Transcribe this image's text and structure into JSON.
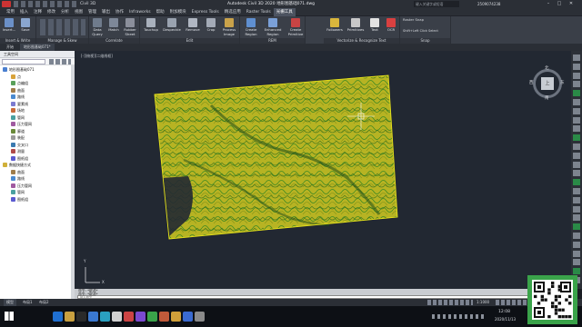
{
  "titlebar": {
    "app_label": "Civil 3D",
    "title": "Autodesk Civil 3D 2020  地形图基础071.dwg",
    "search_placeholder": "键入关键字或短语",
    "user": "2509074238"
  },
  "tabs": [
    "常用",
    "插入",
    "注释",
    "修改",
    "分析",
    "视图",
    "管理",
    "输出",
    "协作",
    "Infraworks",
    "帮助",
    "附加模块",
    "Express Tools",
    "精选应用",
    "Raster Tools",
    "光栅工具"
  ],
  "tabs_active_index": 15,
  "ribbon": {
    "panels": [
      {
        "title": "Insert & Write",
        "buttons": [
          "Insert...",
          "Save"
        ]
      },
      {
        "title": "Manage & Skew",
        "buttons": []
      },
      {
        "title": "Correlate",
        "buttons": [
          "Data Query",
          "Match",
          "Rubber Sheet"
        ]
      },
      {
        "title": "Edit",
        "buttons": [
          "Touchup",
          "Despeckle",
          "Remove",
          "Crop",
          "Process Image"
        ]
      },
      {
        "title": "REM",
        "buttons": [
          "Create Region",
          "Enhanced Region",
          "Create Primitive"
        ]
      },
      {
        "title": "Vectorize & Recognize Text",
        "buttons": [
          "Followers",
          "Primitives",
          "Text",
          "OCR"
        ]
      },
      {
        "title": "Snap",
        "buttons": [
          "Raster Snap",
          "Shift+Left Click Select"
        ]
      }
    ]
  },
  "doc_tabs": [
    "开始",
    "地形图基础071*"
  ],
  "left_panel": {
    "title": "工具空间",
    "items": [
      "地形图基础071",
      "点",
      "点编组",
      "曲面",
      "路线",
      "要素线",
      "场地",
      "管网",
      "压力管网",
      "廊道",
      "装配",
      "交叉口",
      "测量",
      "图纸组",
      "数据快捷方式",
      "曲面",
      "路线",
      "压力管网",
      "管网",
      "图纸组"
    ]
  },
  "viewport": {
    "label": "[-][俯视][二维线框]",
    "compass": {
      "north": "北",
      "south": "南",
      "east": "东",
      "west": "西",
      "center": "上"
    },
    "ucs_x": "X",
    "ucs_y": "Y"
  },
  "command": {
    "line1": "命令: *取消*",
    "line2": "命令: *取消*",
    "prompt_placeholder": "键入命令"
  },
  "layout_tabs": [
    "模型",
    "布局1",
    "布局2"
  ],
  "status_scale": "1:1000",
  "taskbar": {
    "clock_time": "12:08",
    "clock_date": "2020/11/13"
  },
  "colors": {
    "terrain": "#b7b323",
    "contours": "#2f7a1e",
    "terrain_border": "#e6e21a",
    "accent": "#3aa34a"
  }
}
